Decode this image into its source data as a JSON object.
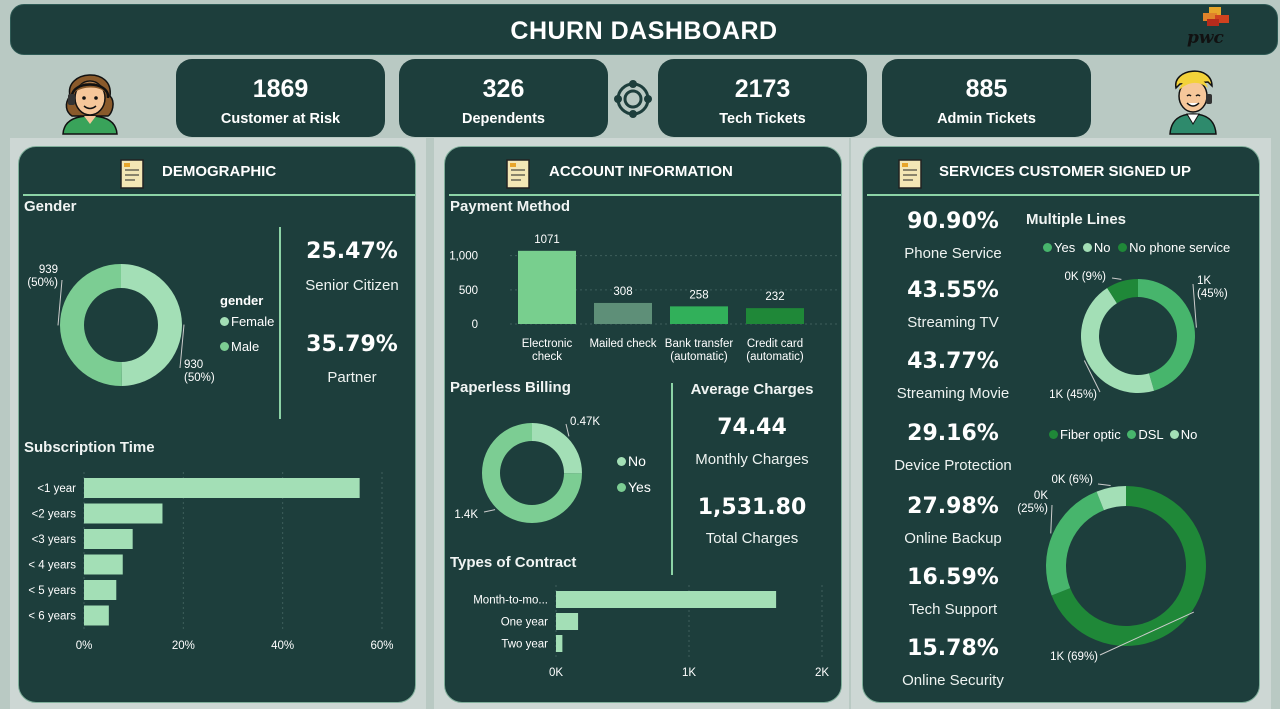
{
  "header": {
    "title": "CHURN DASHBOARD",
    "logo_text": "pwc"
  },
  "kpis": [
    {
      "value": "1869",
      "label": "Customer at Risk"
    },
    {
      "value": "326",
      "label": "Dependents"
    },
    {
      "value": "2173",
      "label": "Tech Tickets"
    },
    {
      "value": "885",
      "label": "Admin Tickets"
    }
  ],
  "demographic": {
    "title": "DEMOGRAPHIC",
    "gender_title": "Gender",
    "legend_title": "gender",
    "senior_value": "25.47%",
    "senior_label": "Senior Citizen",
    "partner_value": "35.79%",
    "partner_label": "Partner",
    "subscription_title": "Subscription Time"
  },
  "account": {
    "title": "ACCOUNT INFORMATION",
    "payment_title": "Payment Method",
    "paperless_title": "Paperless Billing",
    "avg_title": "Average Charges",
    "monthly_value": "74.44",
    "monthly_label": "Monthly Charges",
    "total_value": "1,531.80",
    "total_label": "Total Charges",
    "contract_title": "Types of Contract"
  },
  "services": {
    "title": "SERVICES CUSTOMER SIGNED UP",
    "stats": [
      {
        "value": "90.90%",
        "label": "Phone Service"
      },
      {
        "value": "43.55%",
        "label": "Streaming TV"
      },
      {
        "value": "43.77%",
        "label": "Streaming Movie"
      },
      {
        "value": "29.16%",
        "label": "Device Protection"
      },
      {
        "value": "27.98%",
        "label": "Online Backup"
      },
      {
        "value": "16.59%",
        "label": "Tech Support"
      },
      {
        "value": "15.78%",
        "label": "Online Security"
      }
    ],
    "multiple_lines_title": "Multiple Lines"
  },
  "colors": {
    "panel": "#1d3e3c",
    "light_green": "#a3dfb6",
    "mid_green": "#47b56c",
    "dark_green": "#1f8838",
    "accent_line": "#8cd3a6"
  },
  "chart_data": [
    {
      "id": "gender",
      "type": "pie",
      "donut": true,
      "categories": [
        "Female",
        "Male"
      ],
      "values": [
        930,
        939
      ],
      "labels": [
        "930\n(50%)",
        "939\n(50%)"
      ],
      "legend_title": "gender",
      "colors": [
        "#a3dfb6",
        "#7ccd93"
      ]
    },
    {
      "id": "subscription",
      "type": "bar",
      "orientation": "horizontal",
      "categories": [
        "<1 year",
        "<2 years",
        "<3 years",
        "< 4 years",
        "< 5 years",
        "< 6 years"
      ],
      "values": [
        55.5,
        15.8,
        9.8,
        7.8,
        6.5,
        5.0
      ],
      "ticks": [
        "0%",
        "20%",
        "40%",
        "60%"
      ],
      "xlim": [
        0,
        60
      ],
      "grid": true,
      "color": "#a3dfb6"
    },
    {
      "id": "payment",
      "type": "bar",
      "categories": [
        "Electronic check",
        "Mailed check",
        "Bank transfer (automatic)",
        "Credit card (automatic)"
      ],
      "values": [
        1071,
        308,
        258,
        232
      ],
      "ticks": [
        "0",
        "500",
        "1,000"
      ],
      "ylim": [
        0,
        1200
      ],
      "grid": true,
      "colors": [
        "#78cf8e",
        "#5e8f78",
        "#31b05a",
        "#1f8838"
      ]
    },
    {
      "id": "paperless",
      "type": "pie",
      "donut": true,
      "categories": [
        "No",
        "Yes"
      ],
      "values": [
        0.47,
        1.4
      ],
      "labels": [
        "0.47K",
        "1.4K"
      ],
      "colors": [
        "#a3dfb6",
        "#7ccd93"
      ]
    },
    {
      "id": "contract",
      "type": "bar",
      "orientation": "horizontal",
      "categories": [
        "Month-to-mo...",
        "One year",
        "Two year"
      ],
      "values": [
        1655,
        166,
        48
      ],
      "ticks": [
        "0K",
        "1K",
        "2K"
      ],
      "xlim": [
        0,
        2000
      ],
      "grid": true,
      "color": "#a3dfb6"
    },
    {
      "id": "multiple_lines",
      "type": "pie",
      "donut": true,
      "categories": [
        "Yes",
        "No",
        "No phone service"
      ],
      "values": [
        45,
        45,
        9
      ],
      "labels": [
        "1K\n(45%)",
        "1K (45%)",
        "0K (9%)"
      ],
      "colors": [
        "#47b56c",
        "#a3dfb6",
        "#1f8838"
      ]
    },
    {
      "id": "internet",
      "type": "pie",
      "donut": true,
      "categories": [
        "Fiber optic",
        "DSL",
        "No"
      ],
      "values": [
        69,
        25,
        6
      ],
      "labels": [
        "1K (69%)",
        "0K\n(25%)",
        "0K (6%)"
      ],
      "colors": [
        "#1f8838",
        "#47b56c",
        "#a3dfb6"
      ]
    }
  ]
}
